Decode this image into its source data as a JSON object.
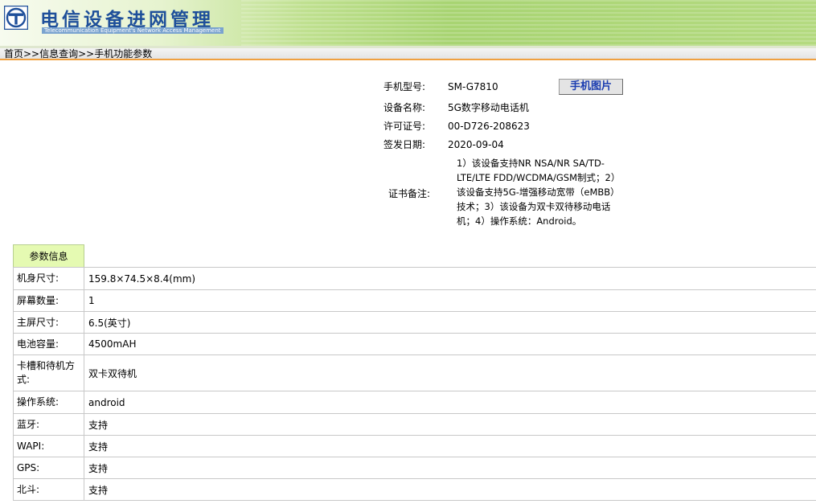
{
  "header": {
    "brand_title": "电信设备进网管理",
    "brand_subtitle": "Telecommunication Equipment's Network Access Management",
    "logo_icon": "network-access-logo-icon",
    "brand_color": "#1e4f9a"
  },
  "breadcrumb": {
    "text": "首页>>信息查询>>手机功能参数"
  },
  "info": {
    "model_label": "手机型号:",
    "model_value": "SM-G7810",
    "photo_button": "手机图片",
    "device_label": "设备名称:",
    "device_value": "5G数字移动电话机",
    "license_label": "许可证号:",
    "license_value": "00-D726-208623",
    "date_label": "签发日期:",
    "date_value": "2020-09-04",
    "remark_label": "证书备注:",
    "remark_value": "1）该设备支持NR NSA/NR SA/TD-LTE/LTE FDD/WCDMA/GSM制式；2）该设备支持5G-增强移动宽带（eMBB）技术；3）该设备为双卡双待移动电话机；4）操作系统：Android。"
  },
  "params": {
    "tab_label": "参数信息",
    "rows": [
      {
        "label": "机身尺寸:",
        "value": "159.8×74.5×8.4(mm)"
      },
      {
        "label": "屏幕数量:",
        "value": "1"
      },
      {
        "label": "主屏尺寸:",
        "value": "6.5(英寸)"
      },
      {
        "label": "电池容量:",
        "value": "4500mAH"
      },
      {
        "label": "卡槽和待机方式:",
        "value": "双卡双待机"
      },
      {
        "label": "操作系统:",
        "value": "android"
      },
      {
        "label": "蓝牙:",
        "value": "支持"
      },
      {
        "label": "WAPI:",
        "value": "支持"
      },
      {
        "label": "GPS:",
        "value": "支持"
      },
      {
        "label": "北斗:",
        "value": "支持"
      }
    ]
  }
}
